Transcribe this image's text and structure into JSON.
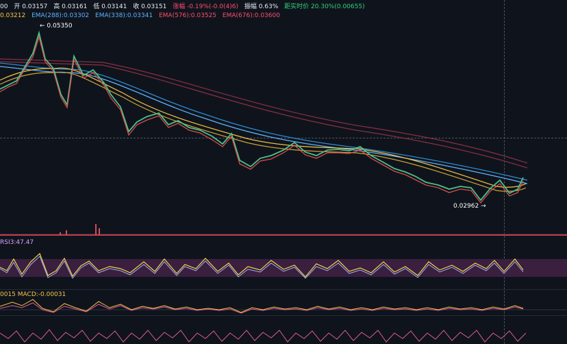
{
  "header": {
    "ohlc": [
      {
        "label": "00",
        "class": "label-white"
      },
      {
        "label": "开 0.03157",
        "class": "label-white"
      },
      {
        "label": "高 0.03161",
        "class": "label-white"
      },
      {
        "label": "低 0.03141",
        "class": "label-white"
      },
      {
        "label": "收 0.03151",
        "class": "label-white"
      },
      {
        "label": "涨幅 -0.19%(-0.0(4)6)",
        "class": "label-red"
      },
      {
        "label": "振幅 0.63%",
        "class": "label-white"
      },
      {
        "label": "距实时价 20.30%(0.00655)",
        "class": "label-green"
      }
    ],
    "ema": [
      {
        "label": "0.03212",
        "class": "label-yellow"
      },
      {
        "label": "EMA(288):0.03302",
        "class": "label-blue"
      },
      {
        "label": "EMA(338):0.03341",
        "class": "label-blue"
      },
      {
        "label": "EMA(576):0.03525",
        "class": "label-red"
      },
      {
        "label": "EMA(676):0.03600",
        "class": "label-red"
      }
    ]
  },
  "markers": {
    "high": "← 0.05350",
    "low": "0.02962 →"
  },
  "panels": {
    "rsi": "RSI3:47.47",
    "macd": "0015   MACD:-0.00031"
  },
  "colors": {
    "up": "#26a69a",
    "down": "#ef5350",
    "ema_yellow": "#f6c445",
    "ema_blue": "#5fb2ff",
    "ema_red": "#8a2f45"
  }
}
